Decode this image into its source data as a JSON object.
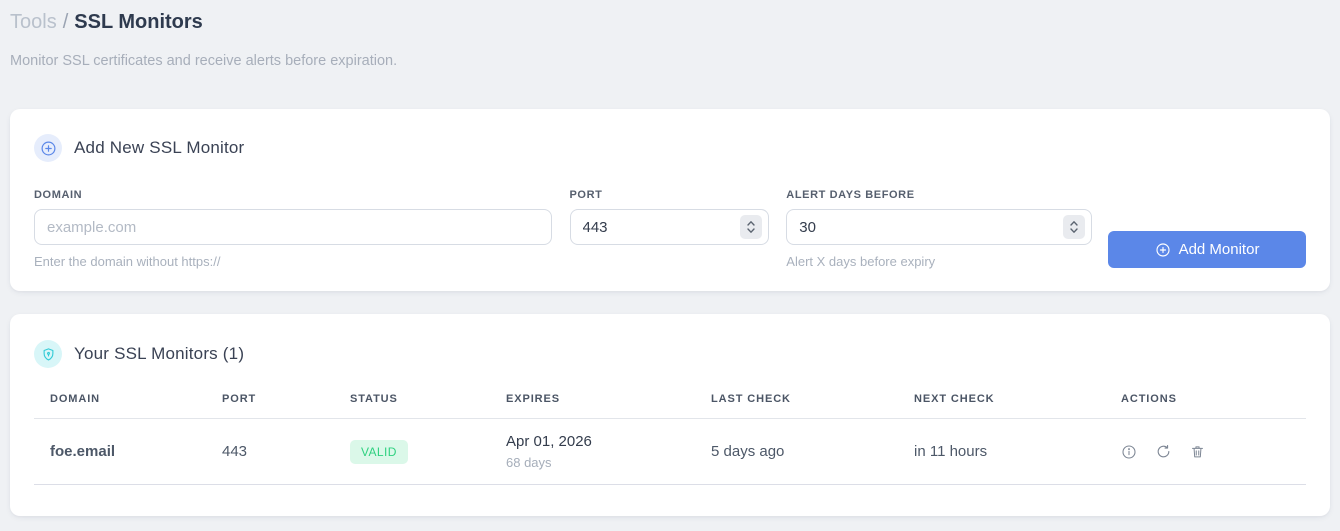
{
  "breadcrumb": {
    "parent": "Tools",
    "separator": "/",
    "current": "SSL Monitors"
  },
  "subtitle": "Monitor SSL certificates and receive alerts before expiration.",
  "add_form": {
    "title": "Add New SSL Monitor",
    "header_icon": "plus-circle-icon",
    "fields": {
      "domain": {
        "label": "DOMAIN",
        "placeholder": "example.com",
        "help": "Enter the domain without https://"
      },
      "port": {
        "label": "PORT",
        "value": "443"
      },
      "alert_days": {
        "label": "ALERT DAYS BEFORE",
        "value": "30",
        "help": "Alert X days before expiry"
      }
    },
    "submit_label": "Add Monitor"
  },
  "monitors": {
    "title": "Your SSL Monitors (1)",
    "header_icon": "shield-lock-icon",
    "columns": [
      "DOMAIN",
      "PORT",
      "STATUS",
      "EXPIRES",
      "LAST CHECK",
      "NEXT CHECK",
      "ACTIONS"
    ],
    "rows": [
      {
        "domain": "foe.email",
        "port": "443",
        "status": "VALID",
        "expires_date": "Apr 01, 2026",
        "expires_days": "68 days",
        "last_check": "5 days ago",
        "next_check": "in 11 hours",
        "action_icons": [
          "info-icon",
          "refresh-icon",
          "trash-icon"
        ]
      }
    ]
  },
  "colors": {
    "accent_blue": "#5b87e8",
    "link_blue": "#6b93ea",
    "valid_badge_bg": "#dbf8e9",
    "valid_badge_text": "#2fd180",
    "plus_badge_bg": "#e6edfc",
    "shield_badge_bg": "#d8f6f8",
    "shield_teal": "#33cbd6",
    "page_bg": "#eff1f4"
  }
}
